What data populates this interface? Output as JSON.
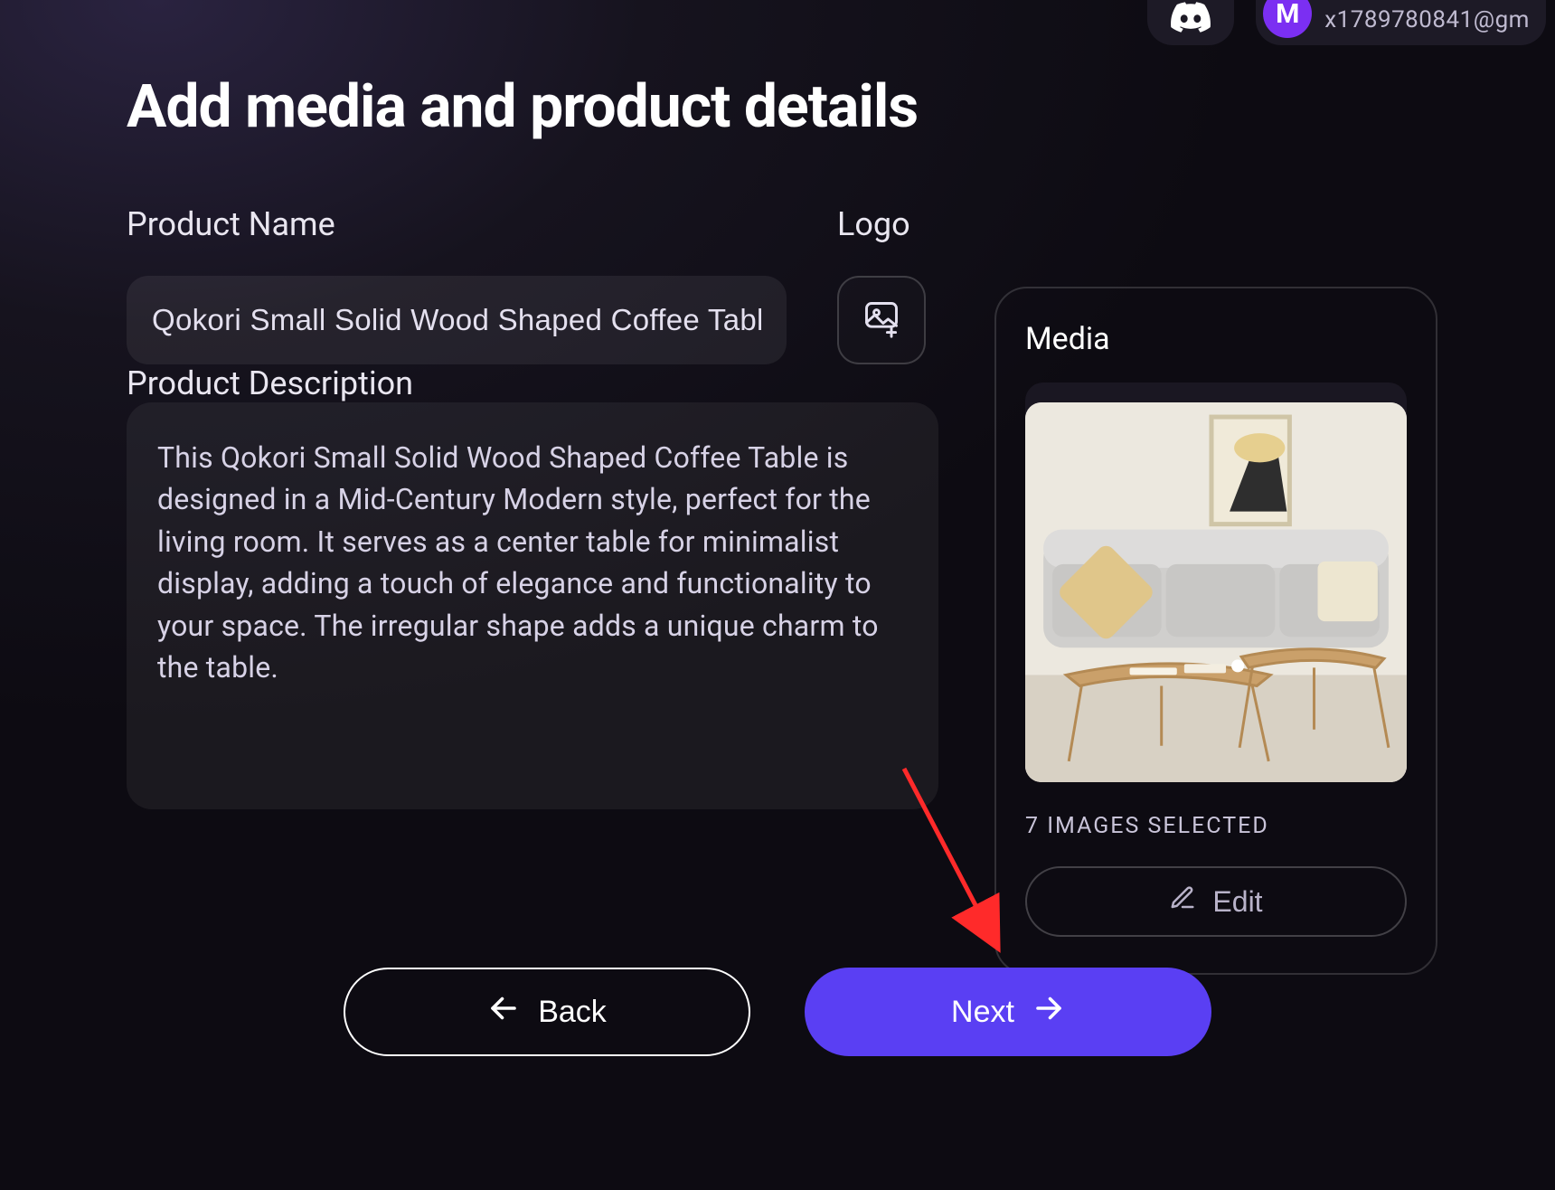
{
  "header": {
    "user_initial": "M",
    "user_email": "x1789780841@gm"
  },
  "page_title": "Add media and product details",
  "labels": {
    "product_name": "Product Name",
    "logo": "Logo",
    "product_description": "Product Description"
  },
  "form": {
    "product_name_value": "Qokori Small Solid Wood Shaped Coffee Table",
    "product_description_value": "This Qokori Small Solid Wood Shaped Coffee Table is designed in a Mid-Century Modern style, perfect for the living room. It serves as a center table for minimalist display, adding a touch of elegance and functionality to your space. The irregular shape adds a unique charm to the table."
  },
  "media": {
    "title": "Media",
    "selected_caption": "7 IMAGES SELECTED",
    "edit_label": "Edit"
  },
  "nav": {
    "back_label": "Back",
    "next_label": "Next"
  },
  "colors": {
    "accent": "#5a3ff3",
    "avatar": "#7b2ff2",
    "annotation": "#ff2a2a"
  }
}
